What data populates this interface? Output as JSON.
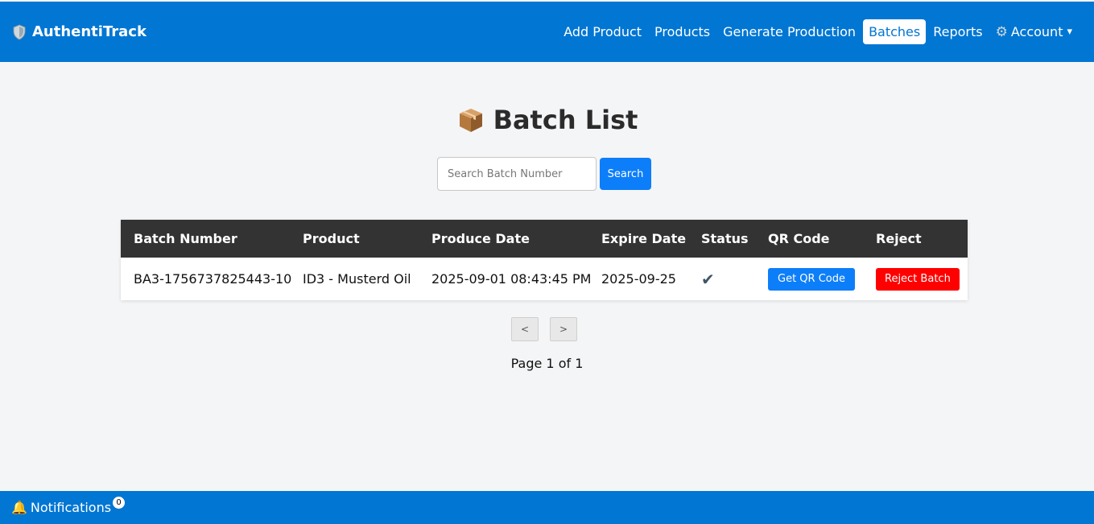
{
  "brand": {
    "name": "AuthentiTrack",
    "icon": "shield-icon"
  },
  "nav": {
    "items": [
      {
        "label": "Add Product",
        "active": false
      },
      {
        "label": "Products",
        "active": false
      },
      {
        "label": "Generate Production",
        "active": false
      },
      {
        "label": "Batches",
        "active": true
      },
      {
        "label": "Reports",
        "active": false
      }
    ],
    "account": {
      "label": "Account",
      "icon": "gear-icon",
      "caret": "▾"
    }
  },
  "page": {
    "title": "Batch List",
    "title_icon": "package-icon"
  },
  "search": {
    "placeholder": "Search Batch Number",
    "value": "",
    "button_label": "Search"
  },
  "table": {
    "headers": [
      "Batch Number",
      "Product",
      "Produce Date",
      "Expire Date",
      "Status",
      "QR Code",
      "Reject"
    ],
    "rows": [
      {
        "batch_number": "BA3-1756737825443-10",
        "product": "ID3 - Musterd Oil",
        "produce_date": "2025-09-01 08:43:45 PM",
        "expire_date": "2025-09-25",
        "status": "✔",
        "qr_button": "Get QR Code",
        "reject_button": "Reject Batch"
      }
    ]
  },
  "pagination": {
    "prev": "<",
    "next": ">",
    "info": "Page 1 of 1"
  },
  "footer": {
    "notifications_label": "Notifications",
    "notifications_count": "0",
    "icon": "bell-icon"
  },
  "colors": {
    "primary": "#0176d3",
    "header_dark": "#333333",
    "button_blue": "#0d7ef9",
    "danger": "#ff0000"
  }
}
